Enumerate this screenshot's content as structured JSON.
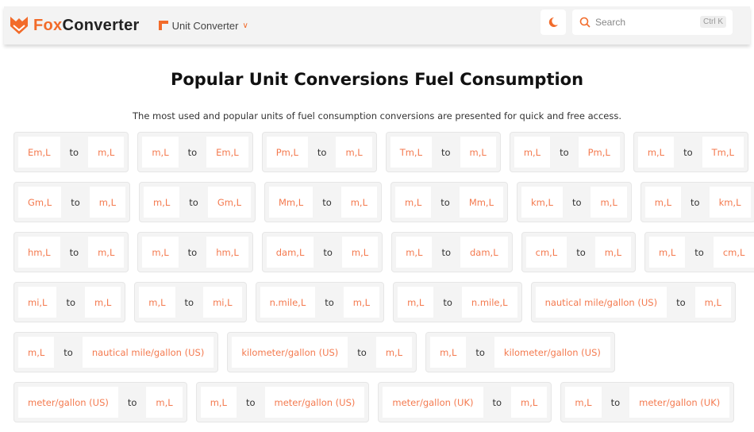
{
  "header": {
    "brand_a": "Fox",
    "brand_b": "Converter",
    "nav_label": "Unit Converter",
    "search_placeholder": "Search",
    "search_shortcut": "Ctrl K"
  },
  "title": "Popular Unit Conversions Fuel Consumption",
  "subtitle": "The most used and popular units of fuel consumption conversions are presented for quick and free access.",
  "connector": "to",
  "colors": {
    "accent": "#f26b2a",
    "chip_text": "#f47a4f"
  },
  "rows": [
    [
      [
        "Em,L",
        "m,L"
      ],
      [
        "m,L",
        "Em,L"
      ],
      [
        "Pm,L",
        "m,L"
      ],
      [
        "Tm,L",
        "m,L"
      ],
      [
        "m,L",
        "Pm,L"
      ],
      [
        "m,L",
        "Tm,L"
      ]
    ],
    [
      [
        "Gm,L",
        "m,L"
      ],
      [
        "m,L",
        "Gm,L"
      ],
      [
        "Mm,L",
        "m,L"
      ],
      [
        "m,L",
        "Mm,L"
      ],
      [
        "km,L",
        "m,L"
      ],
      [
        "m,L",
        "km,L"
      ]
    ],
    [
      [
        "hm,L",
        "m,L"
      ],
      [
        "m,L",
        "hm,L"
      ],
      [
        "dam,L",
        "m,L"
      ],
      [
        "m,L",
        "dam,L"
      ],
      [
        "cm,L",
        "m,L"
      ],
      [
        "m,L",
        "cm,L"
      ]
    ],
    [
      [
        "mi,L",
        "m,L"
      ],
      [
        "m,L",
        "mi,L"
      ],
      [
        "n.mile,L",
        "m,L"
      ],
      [
        "m,L",
        "n.mile,L"
      ],
      [
        "nautical mile/gallon (US)",
        "m,L"
      ]
    ],
    [
      [
        "m,L",
        "nautical mile/gallon (US)"
      ],
      [
        "kilometer/gallon (US)",
        "m,L"
      ],
      [
        "m,L",
        "kilometer/gallon (US)"
      ]
    ],
    [
      [
        "meter/gallon (US)",
        "m,L"
      ],
      [
        "m,L",
        "meter/gallon (US)"
      ],
      [
        "meter/gallon (UK)",
        "m,L"
      ],
      [
        "m,L",
        "meter/gallon (UK)"
      ]
    ]
  ]
}
